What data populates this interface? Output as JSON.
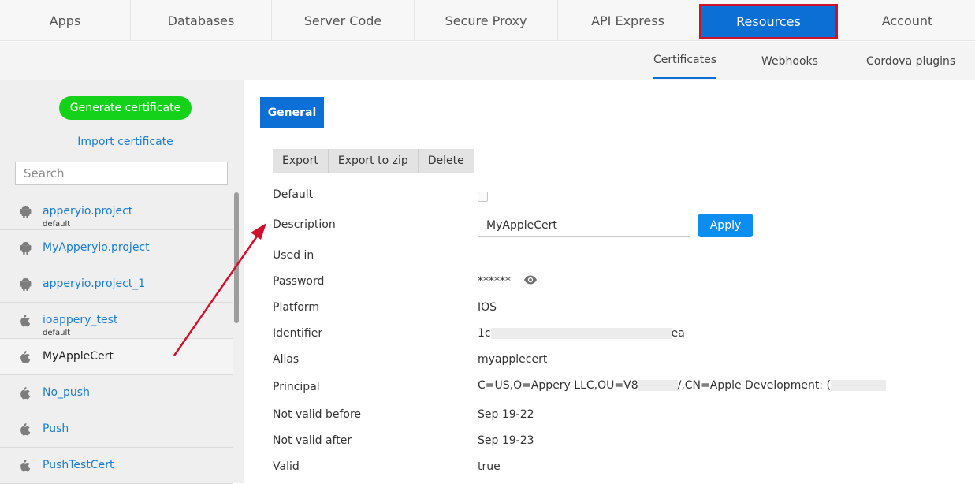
{
  "topnav": {
    "tabs": [
      {
        "label": "Apps"
      },
      {
        "label": "Databases"
      },
      {
        "label": "Server Code"
      },
      {
        "label": "Secure Proxy"
      },
      {
        "label": "API Express"
      },
      {
        "label": "Resources"
      },
      {
        "label": "Account"
      }
    ],
    "active": "Resources",
    "accent_color": "#0b6fd6",
    "highlight_color": "#d0112b"
  },
  "subnav": {
    "items": [
      {
        "label": "Certificates"
      },
      {
        "label": "Webhooks"
      },
      {
        "label": "Cordova plugins"
      }
    ],
    "active": "Certificates"
  },
  "sidebar": {
    "generate_label": "Generate certificate",
    "import_label": "Import certificate",
    "search_placeholder": "Search",
    "items": [
      {
        "name": "apperyio.project",
        "sub": "default",
        "platform": "android-icon"
      },
      {
        "name": "MyApperyio.project",
        "sub": "",
        "platform": "android-icon"
      },
      {
        "name": "apperyio.project_1",
        "sub": "",
        "platform": "android-icon"
      },
      {
        "name": "ioappery_test",
        "sub": "default",
        "platform": "apple-icon"
      },
      {
        "name": "MyAppleCert",
        "sub": "",
        "platform": "apple-icon"
      },
      {
        "name": "No_push",
        "sub": "",
        "platform": "apple-icon"
      },
      {
        "name": "Push",
        "sub": "",
        "platform": "apple-icon"
      },
      {
        "name": "PushTestCert",
        "sub": "",
        "platform": "apple-icon"
      }
    ],
    "selected": "MyAppleCert"
  },
  "main": {
    "tab_label": "General",
    "actions": [
      "Export",
      "Export to zip",
      "Delete"
    ],
    "fields": {
      "default_label": "Default",
      "description_label": "Description",
      "description_value": "MyAppleCert",
      "apply_label": "Apply",
      "used_in_label": "Used in",
      "password_label": "Password",
      "password_value": "******",
      "platform_label": "Platform",
      "platform_value": "IOS",
      "identifier_label": "Identifier",
      "identifier_start": "1c",
      "identifier_end": "ea",
      "alias_label": "Alias",
      "alias_value": "myapplecert",
      "principal_label": "Principal",
      "principal_start": "C=US,O=Appery LLC,OU=V8",
      "principal_mid": "/,CN=Apple Development: (",
      "not_before_label": "Not valid before",
      "not_before_value": "Sep 19-22",
      "not_after_label": "Not valid after",
      "not_after_value": "Sep 19-23",
      "valid_label": "Valid",
      "valid_value": "true"
    }
  }
}
